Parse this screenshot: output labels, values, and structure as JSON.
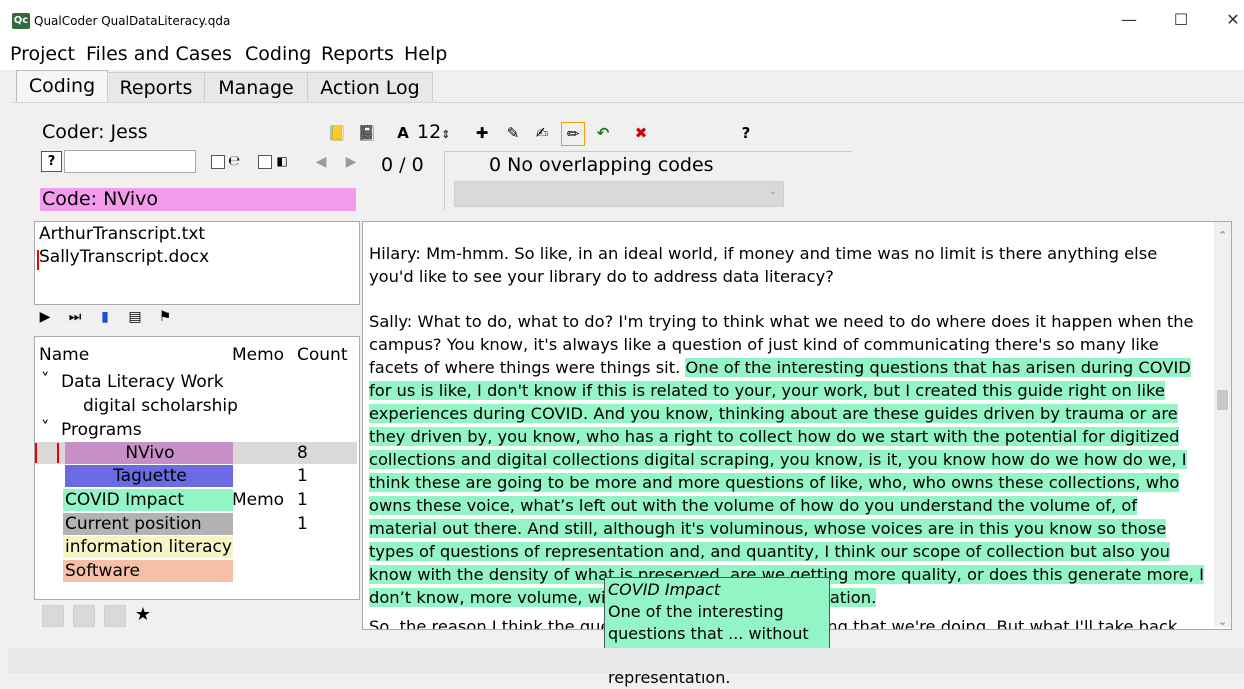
{
  "window": {
    "title": "QualCoder QualDataLiteracy.qda",
    "app_icon_text": "Qc"
  },
  "menu": [
    "Project",
    "Files and Cases",
    "Coding",
    "Reports",
    "Help"
  ],
  "tabs": [
    "Coding",
    "Reports",
    "Manage",
    "Action Log"
  ],
  "coder": "Coder: Jess",
  "font_size": "12",
  "counter": "0 / 0",
  "overlap": "0 No overlapping codes",
  "code_selected": "Code: NVivo",
  "files": [
    "ArthurTranscript.txt",
    "SallyTranscript.docx"
  ],
  "tree": {
    "headers": [
      "Name",
      "Memo",
      "Count"
    ],
    "rows": [
      {
        "name": "Data Literacy Work",
        "memo": "",
        "count": "",
        "color": ""
      },
      {
        "name": "digital scholarship",
        "memo": "",
        "count": "",
        "color": ""
      },
      {
        "name": "Programs",
        "memo": "",
        "count": "",
        "color": ""
      },
      {
        "name": "NVivo",
        "memo": "",
        "count": "8",
        "color": "#c78fc6"
      },
      {
        "name": "Taguette",
        "memo": "",
        "count": "1",
        "color": "#6a6ae3"
      },
      {
        "name": "COVID Impact",
        "memo": "Memo",
        "count": "1",
        "color": "#93f5c5"
      },
      {
        "name": "Current position",
        "memo": "",
        "count": "1",
        "color": "#b3b3b3"
      },
      {
        "name": "information literacy",
        "memo": "",
        "count": "",
        "color": "#f7f5c6"
      },
      {
        "name": "Software",
        "memo": "",
        "count": "",
        "color": "#f6bfa8"
      }
    ]
  },
  "text": {
    "p1": "Hilary: Mm-hmm. So like, in an ideal world, if money and time was no limit is there anything else you'd like to see your library do to address data literacy?",
    "p2_plain": "Sally: What to do, what to do? I'm trying to think what we need to do where does it happen when the campus? You know, it's always like a question of just kind of communicating there's so many like facets of where things were things sit. ",
    "p2_coded": "One of the interesting questions that has arisen during COVID for us is like, I don't know if this is related to your, your work, but I created this guide right on like experiences during COVID. And you know, thinking about are these guides driven by trauma or are they driven by, you know, who has a right to collect how do we start with the potential for digitized collections and digital collections digital scraping, you know, is it, you know how do we how do we, I think these are going to be more and more questions of like, who, who owns these collections, who owns these voice, what’s left out with the volume of how do you understand the volume of, of material out there. And still, although it's voluminous, whose voices are in this you know so those types of questions of representation and, and quantity, I think our scope of collection but also you know with the density of what is preserved, are we getting more quality, or does this generate more, I don’t know, more volume, without really more representation.",
    "p3": "So, the reason I think the question was actually something that we're doing. But what I'll take back"
  },
  "tooltip": {
    "title": "COVID Impact",
    "body": "One of the interesting questions that ... without really more representation."
  }
}
